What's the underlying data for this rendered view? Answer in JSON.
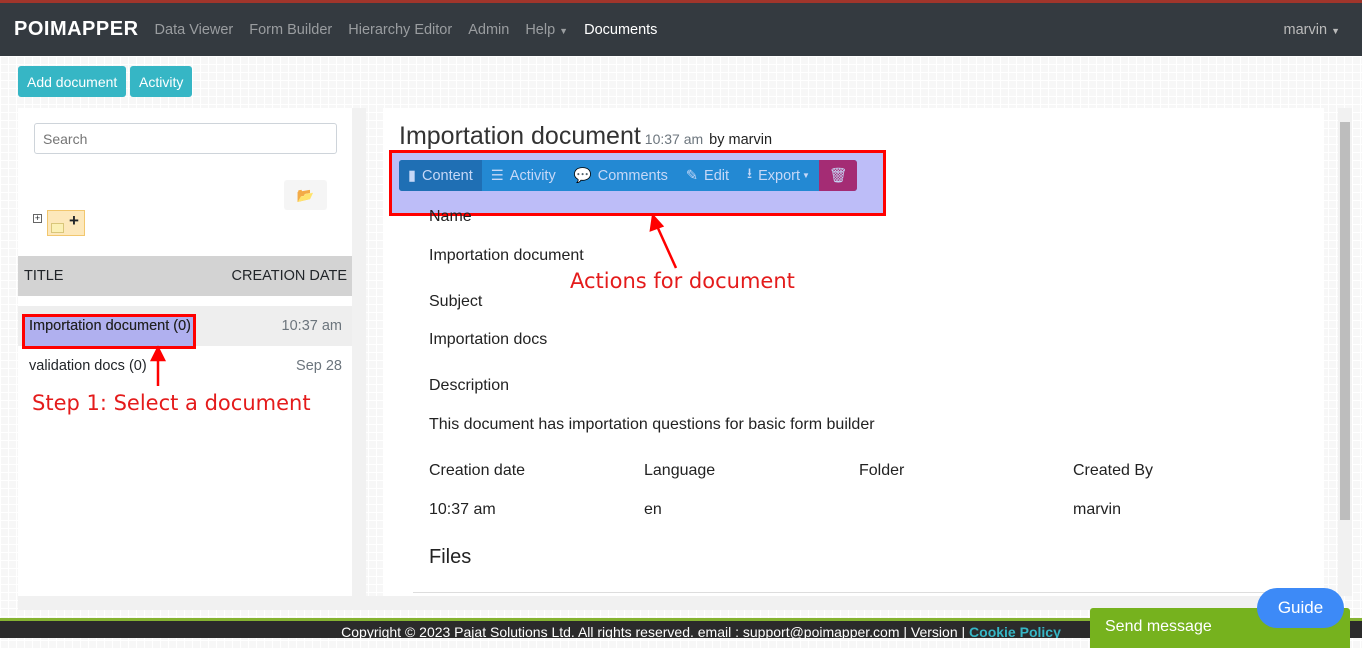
{
  "nav": {
    "logo": "POIMAPPER",
    "items": [
      "Data Viewer",
      "Form Builder",
      "Hierarchy Editor",
      "Admin",
      "Help",
      "Documents"
    ],
    "active": "Documents",
    "user": "marvin"
  },
  "actions": {
    "add_document": "Add document",
    "activity": "Activity"
  },
  "left": {
    "search_placeholder": "Search",
    "columns": {
      "title": "TITLE",
      "date": "CREATION DATE"
    },
    "rows": [
      {
        "title": "Importation document (0)",
        "date": "10:37 am",
        "selected": true
      },
      {
        "title": "validation docs (0)",
        "date": "Sep 28",
        "selected": false
      }
    ]
  },
  "doc": {
    "title": "Importation document",
    "time": "10:37 am",
    "by": "by marvin",
    "toolbar": {
      "content": "Content",
      "activity": "Activity",
      "comments": "Comments",
      "edit": "Edit",
      "export": "Export"
    },
    "name_label": "Name",
    "name": "Importation document",
    "subject_label": "Subject",
    "subject": "Importation docs",
    "description_label": "Description",
    "description": "This document has importation questions for basic form builder",
    "meta_labels": [
      "Creation date",
      "Language",
      "Folder",
      "Created By"
    ],
    "meta_values": [
      "10:37 am",
      "en",
      "",
      "marvin"
    ],
    "files_label": "Files"
  },
  "annotations": {
    "step1": "Step 1: Select a document",
    "actions": "Actions for document"
  },
  "footer": {
    "text": "Copyright © 2023 Pajat Solutions Ltd. All rights reserved. email : support@poimapper.com | Version | ",
    "cookie": "Cookie Policy"
  },
  "widgets": {
    "send": "Send message",
    "guide": "Guide"
  },
  "colors": {
    "navbar": "#343a40",
    "accent": "#36b6c5",
    "toolbar": "#2389d3",
    "delete": "#a42c74",
    "annotation": "#ff0000",
    "highlight": "#bdbdf8"
  }
}
